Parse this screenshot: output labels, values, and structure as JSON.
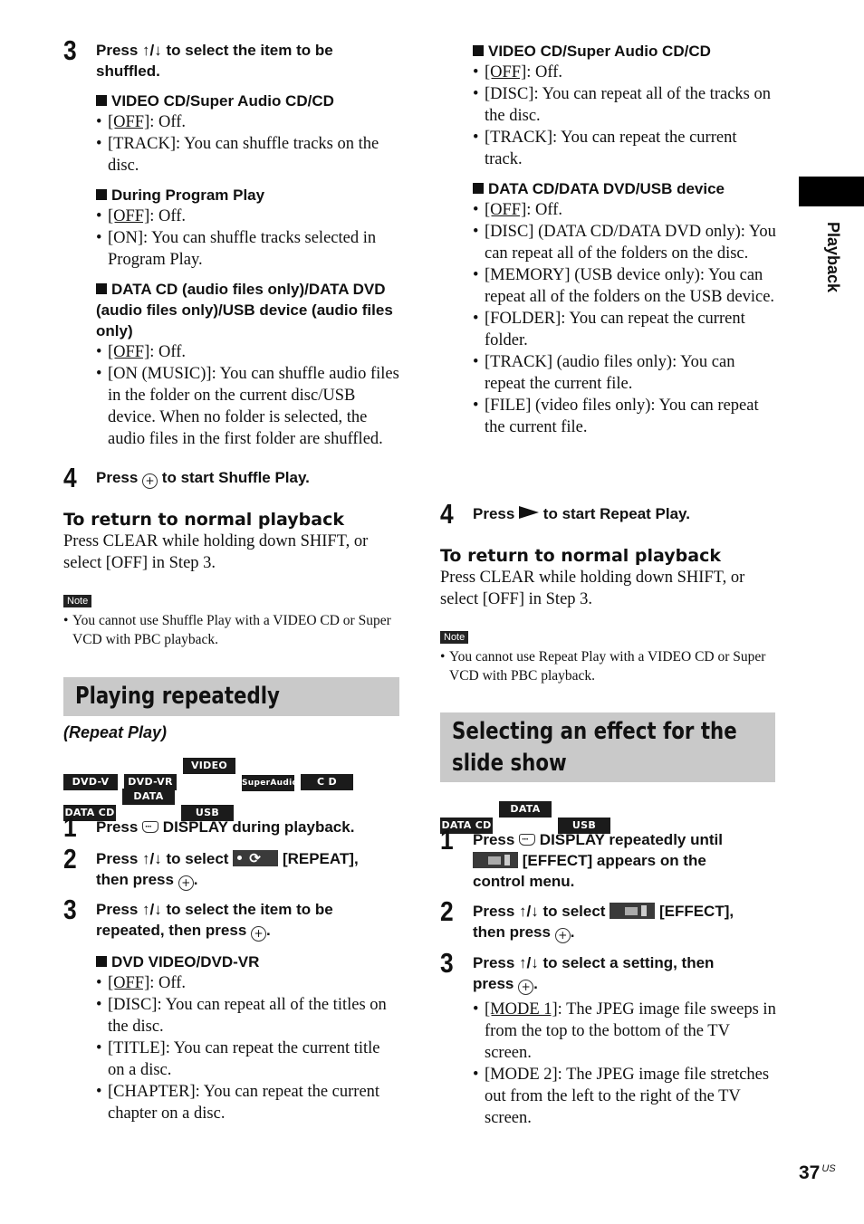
{
  "side_tab": {
    "label": "Playback"
  },
  "page": {
    "number": "37",
    "suffix": "US"
  },
  "left": {
    "step3": {
      "num": "3",
      "text": "Press ↑/↓ to select the item to be shuffled.",
      "groups": [
        {
          "heading": "VIDEO CD/Super Audio CD/CD",
          "items": [
            {
              "key": "[OFF]",
              "rest": ": Off.",
              "underline": true
            },
            {
              "key": "[TRACK]",
              "rest": ": You can shuffle tracks on the disc.",
              "underline": false
            }
          ]
        },
        {
          "heading": "During Program Play",
          "items": [
            {
              "key": "[OFF]",
              "rest": ": Off.",
              "underline": true
            },
            {
              "key": "[ON]",
              "rest": ": You can shuffle tracks selected in Program Play.",
              "underline": false
            }
          ]
        },
        {
          "heading": "DATA CD (audio files only)/DATA DVD (audio files only)/USB device (audio files only)",
          "items": [
            {
              "key": "[OFF]",
              "rest": ": Off.",
              "underline": true
            },
            {
              "key": "[ON (MUSIC)]",
              "rest": ": You can shuffle audio files in the folder on the current disc/USB device. When no folder is selected, the audio files in the first folder are shuffled.",
              "underline": false
            }
          ]
        }
      ]
    },
    "step4": {
      "num": "4",
      "pre": "Press",
      "post": "to start Shuffle Play."
    },
    "return_heading": "To return to normal playback",
    "return_text": "Press CLEAR while holding down SHIFT, or select [OFF] in Step 3.",
    "note_label": "Note",
    "note_text": "You cannot use Shuffle Play with a VIDEO CD or Super VCD with PBC playback.",
    "section_title": "Playing repeatedly",
    "section_subtitle": "(Repeat Play)",
    "tags_row1": [
      "DVD-V",
      "DVD-VR",
      "VIDEO CD",
      "SuperAudioCD",
      "C D"
    ],
    "tags_row2": [
      "DATA CD",
      "DATA DVD",
      "USB"
    ],
    "r_step1": {
      "num": "1",
      "pre": "Press",
      "post": "DISPLAY during playback."
    },
    "r_step2": {
      "num": "2",
      "pre": "Press ↑/↓ to select",
      "post": "[REPEAT],",
      "line2": "then press",
      "end": "."
    },
    "r_step3": {
      "num": "3",
      "line1": "Press ↑/↓ to select the item to be",
      "line2": "repeated, then press",
      "end": ".",
      "groups": [
        {
          "heading": "DVD VIDEO/DVD-VR",
          "items": [
            {
              "key": "[OFF]",
              "rest": ": Off.",
              "underline": true
            },
            {
              "key": "[DISC]",
              "rest": ": You can repeat all of the titles on the disc.",
              "underline": false
            },
            {
              "key": "[TITLE]",
              "rest": ": You can repeat the current title on a disc.",
              "underline": false
            },
            {
              "key": "[CHAPTER]",
              "rest": ": You can repeat the current chapter on a disc.",
              "underline": false
            }
          ]
        }
      ]
    }
  },
  "right": {
    "groups": [
      {
        "heading": "VIDEO CD/Super Audio CD/CD",
        "items": [
          {
            "key": "[OFF]",
            "rest": ": Off.",
            "underline": true
          },
          {
            "key": "[DISC]",
            "rest": ": You can repeat all of the tracks on the disc.",
            "underline": false
          },
          {
            "key": "[TRACK]",
            "rest": ": You can repeat the current track.",
            "underline": false
          }
        ]
      },
      {
        "heading": "DATA CD/DATA DVD/USB device",
        "items": [
          {
            "key": "[OFF]",
            "rest": ": Off.",
            "underline": true
          },
          {
            "key": "[DISC]",
            "rest": " (DATA CD/DATA DVD only): You can repeat all of the folders on the disc.",
            "underline": false
          },
          {
            "key": "[MEMORY]",
            "rest": " (USB device only): You can repeat all of the folders on the USB device.",
            "underline": false
          },
          {
            "key": "[FOLDER]",
            "rest": ": You can repeat the current folder.",
            "underline": false
          },
          {
            "key": "[TRACK]",
            "rest": " (audio files only): You can repeat the current file.",
            "underline": false
          },
          {
            "key": "[FILE]",
            "rest": " (video files only): You can repeat the current file.",
            "underline": false
          }
        ]
      }
    ],
    "step4": {
      "num": "4",
      "pre": "Press",
      "post": "to start Repeat Play."
    },
    "return_heading": "To return to normal playback",
    "return_text": "Press CLEAR while holding down SHIFT, or select [OFF] in Step 3.",
    "note_label": "Note",
    "note_text": "You cannot use Repeat Play with a VIDEO CD or Super VCD with PBC playback.",
    "section_title_l1": "Selecting an effect for the",
    "section_title_l2": "slide show",
    "tags": [
      "DATA CD",
      "DATA DVD",
      "USB"
    ],
    "e_step1": {
      "num": "1",
      "pre": "Press",
      "post": "DISPLAY repeatedly until",
      "line2": "[EFFECT] appears on the",
      "line3": "control menu."
    },
    "e_step2": {
      "num": "2",
      "pre": "Press ↑/↓ to select",
      "post": "[EFFECT],",
      "line2": "then press",
      "end": "."
    },
    "e_step3": {
      "num": "3",
      "line1": "Press ↑/↓ to select a setting, then",
      "line2": "press",
      "end": ".",
      "items": [
        {
          "key": "[MODE 1]",
          "rest": ": The JPEG image file sweeps in from the top to the bottom of the TV screen.",
          "underline": true
        },
        {
          "key": "[MODE 2]",
          "rest": ": The JPEG image file stretches out from the left to the right of the TV screen.",
          "underline": false
        }
      ]
    }
  }
}
